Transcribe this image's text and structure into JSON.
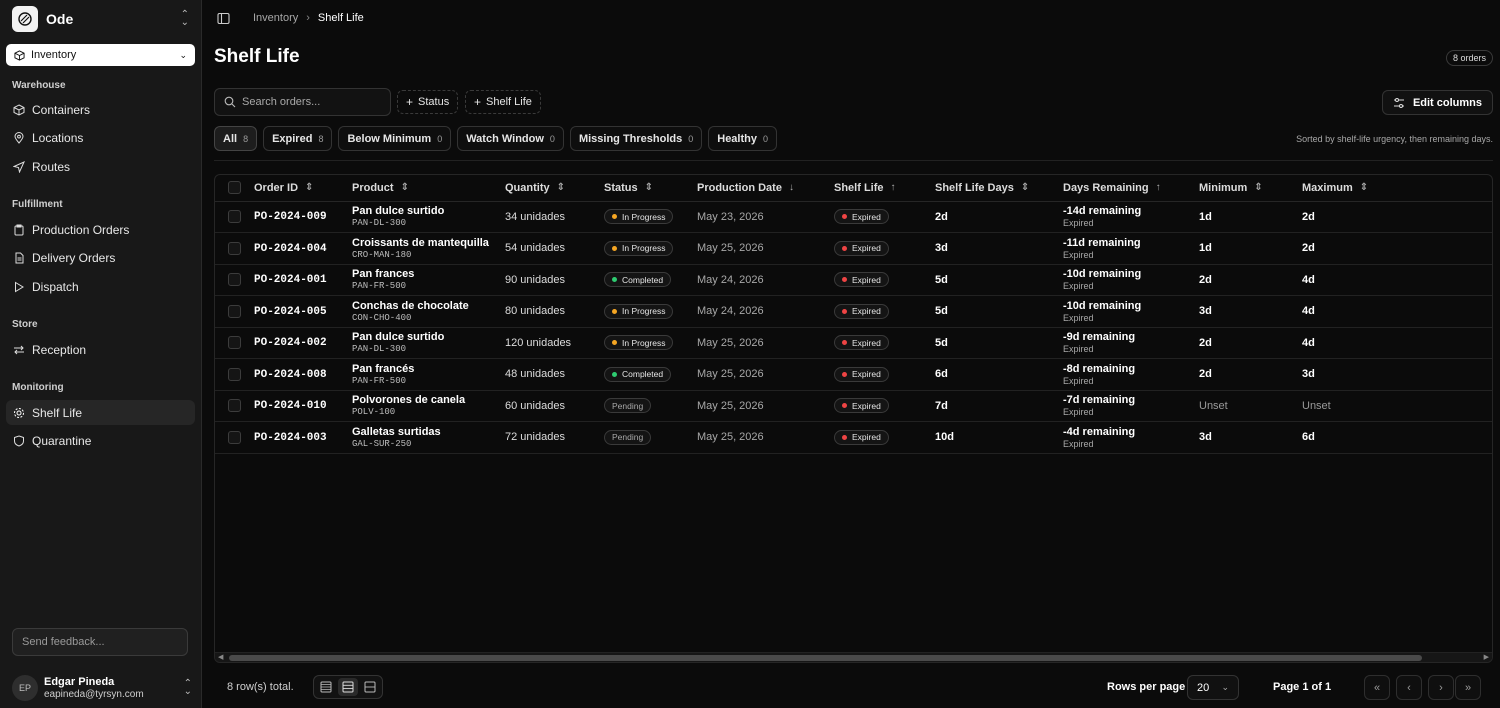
{
  "sidebar": {
    "brand": "Ode",
    "module": "Inventory",
    "sections": [
      {
        "title": "Warehouse",
        "items": [
          {
            "label": "Containers",
            "icon": "box-icon"
          },
          {
            "label": "Locations",
            "icon": "map-pin-icon"
          },
          {
            "label": "Routes",
            "icon": "send-icon"
          }
        ]
      },
      {
        "title": "Fulfillment",
        "items": [
          {
            "label": "Production Orders",
            "icon": "clipboard-icon"
          },
          {
            "label": "Delivery Orders",
            "icon": "file-icon"
          },
          {
            "label": "Dispatch",
            "icon": "play-icon"
          }
        ]
      },
      {
        "title": "Store",
        "items": [
          {
            "label": "Reception",
            "icon": "swap-icon"
          }
        ]
      },
      {
        "title": "Monitoring",
        "items": [
          {
            "label": "Shelf Life",
            "icon": "gear-icon"
          },
          {
            "label": "Quarantine",
            "icon": "shield-icon"
          }
        ]
      }
    ],
    "feedback_placeholder": "Send feedback...",
    "user": {
      "initials": "EP",
      "name": "Edgar Pineda",
      "email": "eapineda@tyrsyn.com"
    }
  },
  "header": {
    "breadcrumb": [
      "Inventory",
      "Shelf Life"
    ],
    "title": "Shelf Life",
    "orders_badge": "8 orders"
  },
  "toolbar": {
    "search_placeholder": "Search orders...",
    "filters": [
      "Status",
      "Shelf Life"
    ],
    "edit_columns": "Edit columns"
  },
  "tabs": [
    {
      "label": "All",
      "count": "8"
    },
    {
      "label": "Expired",
      "count": "8"
    },
    {
      "label": "Below Minimum",
      "count": "0"
    },
    {
      "label": "Watch Window",
      "count": "0"
    },
    {
      "label": "Missing Thresholds",
      "count": "0"
    },
    {
      "label": "Healthy",
      "count": "0"
    }
  ],
  "sort_note": "Sorted by shelf-life urgency, then remaining days.",
  "table": {
    "columns": [
      "Order ID",
      "Product",
      "Quantity",
      "Status",
      "Production Date",
      "Shelf Life",
      "Shelf Life Days",
      "Days Remaining",
      "Minimum",
      "Maximum"
    ],
    "rows": [
      {
        "id": "PO-2024-009",
        "product": "Pan dulce surtido",
        "sku": "PAN-DL-300",
        "qty": "34 unidades",
        "status": "In Progress",
        "date": "May 23, 2026",
        "shelf": "Expired",
        "days": "2d",
        "remain": "-14d remaining",
        "remain_sub": "Expired",
        "min": "1d",
        "max": "2d"
      },
      {
        "id": "PO-2024-004",
        "product": "Croissants de mantequilla",
        "sku": "CRO-MAN-180",
        "qty": "54 unidades",
        "status": "In Progress",
        "date": "May 25, 2026",
        "shelf": "Expired",
        "days": "3d",
        "remain": "-11d remaining",
        "remain_sub": "Expired",
        "min": "1d",
        "max": "2d"
      },
      {
        "id": "PO-2024-001",
        "product": "Pan frances",
        "sku": "PAN-FR-500",
        "qty": "90 unidades",
        "status": "Completed",
        "date": "May 24, 2026",
        "shelf": "Expired",
        "days": "5d",
        "remain": "-10d remaining",
        "remain_sub": "Expired",
        "min": "2d",
        "max": "4d"
      },
      {
        "id": "PO-2024-005",
        "product": "Conchas de chocolate",
        "sku": "CON-CHO-400",
        "qty": "80 unidades",
        "status": "In Progress",
        "date": "May 24, 2026",
        "shelf": "Expired",
        "days": "5d",
        "remain": "-10d remaining",
        "remain_sub": "Expired",
        "min": "3d",
        "max": "4d"
      },
      {
        "id": "PO-2024-002",
        "product": "Pan dulce surtido",
        "sku": "PAN-DL-300",
        "qty": "120 unidades",
        "status": "In Progress",
        "date": "May 25, 2026",
        "shelf": "Expired",
        "days": "5d",
        "remain": "-9d remaining",
        "remain_sub": "Expired",
        "min": "2d",
        "max": "4d"
      },
      {
        "id": "PO-2024-008",
        "product": "Pan francés",
        "sku": "PAN-FR-500",
        "qty": "48 unidades",
        "status": "Completed",
        "date": "May 25, 2026",
        "shelf": "Expired",
        "days": "6d",
        "remain": "-8d remaining",
        "remain_sub": "Expired",
        "min": "2d",
        "max": "3d"
      },
      {
        "id": "PO-2024-010",
        "product": "Polvorones de canela",
        "sku": "POLV-100",
        "qty": "60 unidades",
        "status": "Pending",
        "date": "May 25, 2026",
        "shelf": "Expired",
        "days": "7d",
        "remain": "-7d remaining",
        "remain_sub": "Expired",
        "min": "Unset",
        "max": "Unset"
      },
      {
        "id": "PO-2024-003",
        "product": "Galletas surtidas",
        "sku": "GAL-SUR-250",
        "qty": "72 unidades",
        "status": "Pending",
        "date": "May 25, 2026",
        "shelf": "Expired",
        "days": "10d",
        "remain": "-4d remaining",
        "remain_sub": "Expired",
        "min": "3d",
        "max": "6d"
      }
    ]
  },
  "footer": {
    "total": "8 row(s) total.",
    "rows_per_page_label": "Rows per page",
    "rows_per_page": "20",
    "page_label": "Page 1 of 1"
  },
  "colors": {
    "in_progress": "#f5a623",
    "completed": "#2ecc71",
    "expired": "#ef4444"
  }
}
